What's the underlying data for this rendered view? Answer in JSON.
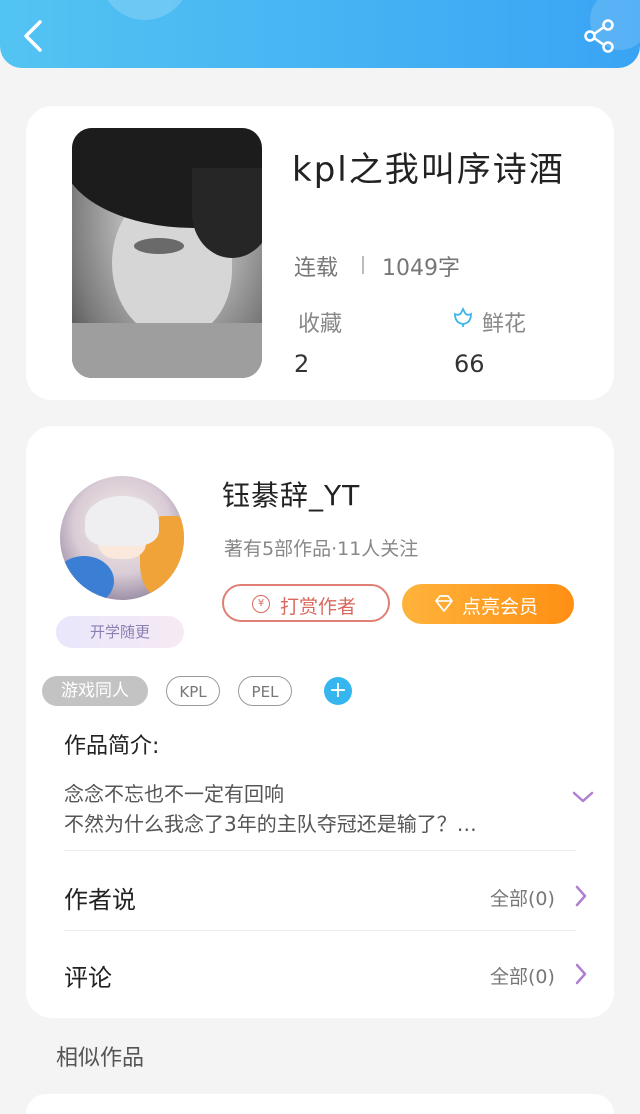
{
  "colors": {
    "accent": "#36b6ee",
    "header": "#3aa4f4",
    "tip": "#d8695f",
    "vip": "#ff9b20"
  },
  "nav": {
    "back_icon": "chevron-left-icon",
    "share_icon": "share-icon"
  },
  "book": {
    "title": "kpl之我叫序诗酒",
    "status": "连载",
    "word_count": "1049字",
    "favorites_label": "收藏",
    "favorites_value": "2",
    "flowers_label": "鲜花",
    "flowers_value": "66"
  },
  "author": {
    "name": "钰綦辞_YT",
    "meta": "著有5部作品·11人关注",
    "badge": "开学随更",
    "tip_label": "打赏作者",
    "vip_label": "点亮会员"
  },
  "tags": [
    "游戏同人",
    "KPL",
    "PEL"
  ],
  "intro": {
    "title": "作品简介:",
    "line1": "念念不忘也不一定有回响",
    "line2": "不然为什么我念了3年的主队夺冠还是输了？…"
  },
  "rows": [
    {
      "label": "作者说",
      "all": "全部(0)"
    },
    {
      "label": "评论",
      "all": "全部(0)"
    }
  ],
  "similar_title": "相似作品"
}
